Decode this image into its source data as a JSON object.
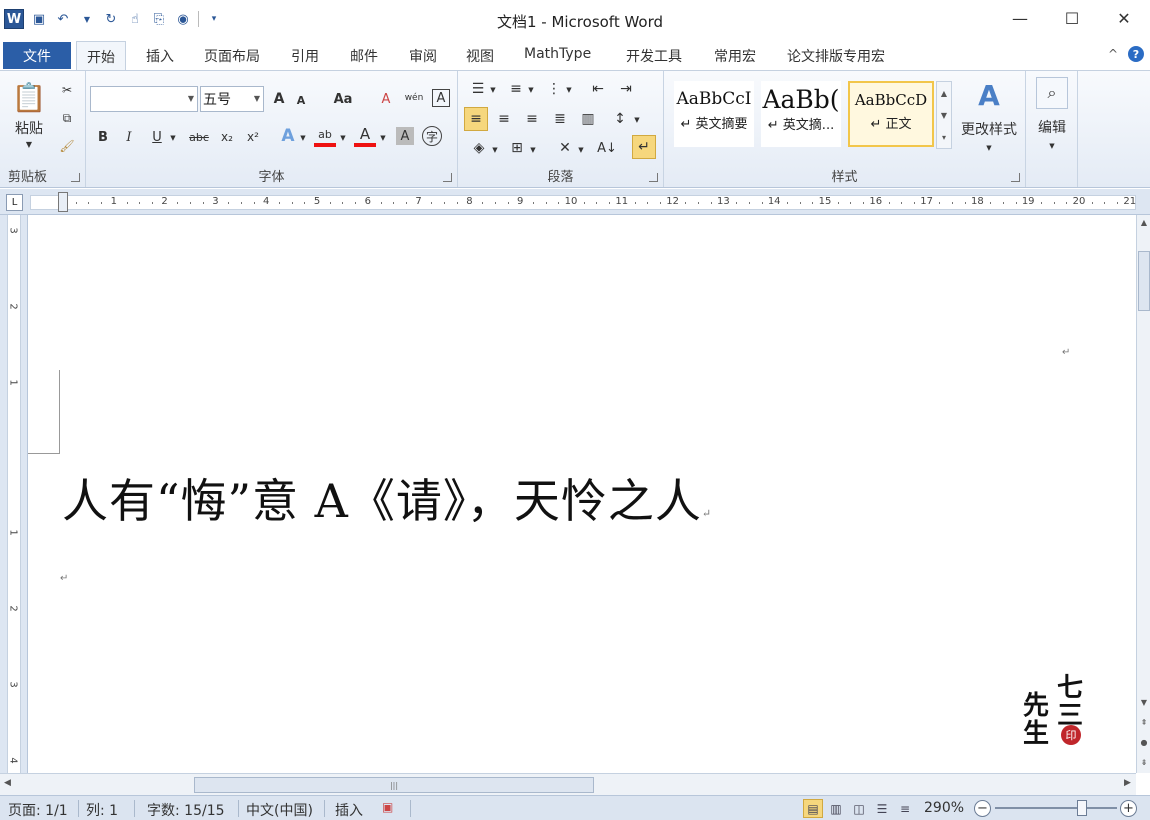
{
  "window": {
    "title": "文档1 - Microsoft Word",
    "app_icon": "W",
    "controls": [
      "—",
      "☐",
      "✕"
    ]
  },
  "qat": [
    "save-icon",
    "undo-icon",
    "redo-icon",
    "touch-icon",
    "format-painter-icon",
    "tab-icon",
    "customize-icon"
  ],
  "tabs": {
    "file": "文件",
    "items": [
      "开始",
      "插入",
      "页面布局",
      "引用",
      "邮件",
      "审阅",
      "视图",
      "MathType",
      "开发工具",
      "常用宏",
      "论文排版专用宏"
    ],
    "active": "开始",
    "collapse": "^",
    "help": "?"
  },
  "ribbon": {
    "clipboard": {
      "label": "剪贴板",
      "paste": "粘贴"
    },
    "font": {
      "label": "字体",
      "font_name": "",
      "font_size": "五号",
      "grow": "A",
      "shrink": "A",
      "case": "Aa",
      "clear": "A",
      "bold": "B",
      "italic": "I",
      "underline": "U",
      "strike": "abc",
      "sub": "x₂",
      "sup": "x²",
      "effects": "A",
      "highlight": "ab",
      "color": "A",
      "shade": "A",
      "enclose": "字",
      "phonetic": "wén",
      "border": "A"
    },
    "paragraph": {
      "label": "段落"
    },
    "styles": {
      "label": "样式",
      "items": [
        {
          "sample": "AaBbCcI",
          "name": "↵ 英文摘要"
        },
        {
          "sample": "AaBb(",
          "name": "↵ 英文摘..."
        },
        {
          "sample": "AaBbCcD",
          "name": "↵ 正文"
        }
      ],
      "change": "更改样式"
    },
    "editing": {
      "label": "编辑"
    }
  },
  "ruler": {
    "numbers": [
      "1",
      "2",
      "3",
      "4",
      "5",
      "6",
      "7",
      "8",
      "9",
      "10",
      "11",
      "12",
      "13",
      "14",
      "15",
      "16",
      "17",
      "18",
      "19",
      "20",
      "21"
    ],
    "vnumbers": [
      "3",
      "2",
      "1",
      "1",
      "2",
      "3",
      "4"
    ]
  },
  "document": {
    "line": "人有“悔”意 A《请》，天怜之人",
    "para_mark": "↵",
    "logo": {
      "c1": "先",
      "c2": "七",
      "c3": "生",
      "c4": "三",
      "seal": "印"
    }
  },
  "status": {
    "page": "页面: 1/1",
    "col": "列: 1",
    "words": "字数: 15/15",
    "lang": "中文(中国)",
    "mode": "插入",
    "zoom": "290%",
    "minus": "−",
    "plus": "+"
  },
  "scrollbar": {
    "up": "▲",
    "down": "▼",
    "left": "◀",
    "right": "▶",
    "grip": "|||"
  }
}
